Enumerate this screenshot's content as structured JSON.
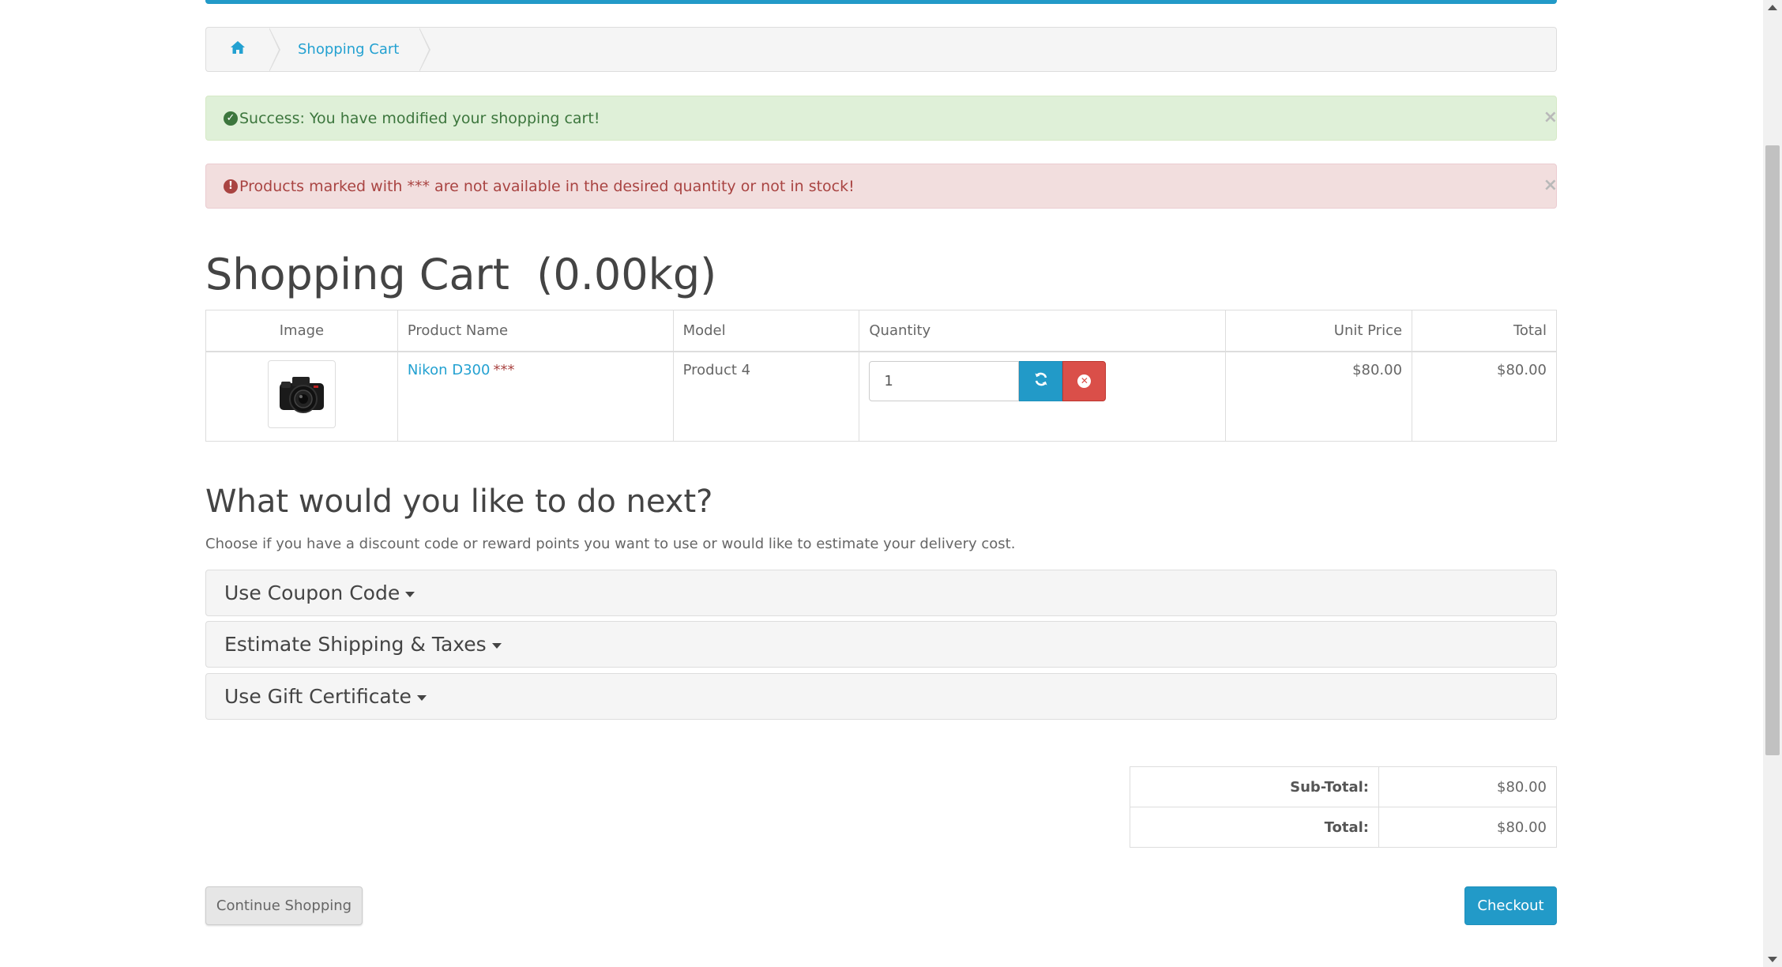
{
  "colors": {
    "accent": "#229ac8",
    "link": "#23a1d1",
    "success": "#3c763d",
    "danger": "#a94442"
  },
  "breadcrumb": {
    "home_icon": "home-icon",
    "cart_label": "Shopping Cart"
  },
  "alerts": {
    "success": {
      "icon": "check-circle-icon",
      "text": "Success: You have modified your shopping cart!",
      "close": "×"
    },
    "danger": {
      "icon": "exclamation-circle-icon",
      "text": "Products marked with *** are not available in the desired quantity or not in stock!",
      "close": "×"
    }
  },
  "page_title": "Shopping Cart  (0.00kg)",
  "cart_table": {
    "headers": [
      "Image",
      "Product Name",
      "Model",
      "Quantity",
      "Unit Price",
      "Total"
    ],
    "rows": [
      {
        "image": "camera-thumbnail",
        "name": "Nikon D300",
        "stock_mark": "***",
        "model": "Product 4",
        "quantity": "1",
        "unit_price": "$80.00",
        "total": "$80.00"
      }
    ],
    "update_icon": "refresh-icon",
    "remove_icon": "times-circle-icon"
  },
  "next_section": {
    "heading": "What would you like to do next?",
    "description": "Choose if you have a discount code or reward points you want to use or would like to estimate your delivery cost.",
    "panels": [
      "Use Coupon Code",
      "Estimate Shipping & Taxes",
      "Use Gift Certificate"
    ]
  },
  "totals": [
    {
      "label": "Sub-Total:",
      "value": "$80.00"
    },
    {
      "label": "Total:",
      "value": "$80.00"
    }
  ],
  "buttons": {
    "continue": "Continue Shopping",
    "checkout": "Checkout"
  }
}
